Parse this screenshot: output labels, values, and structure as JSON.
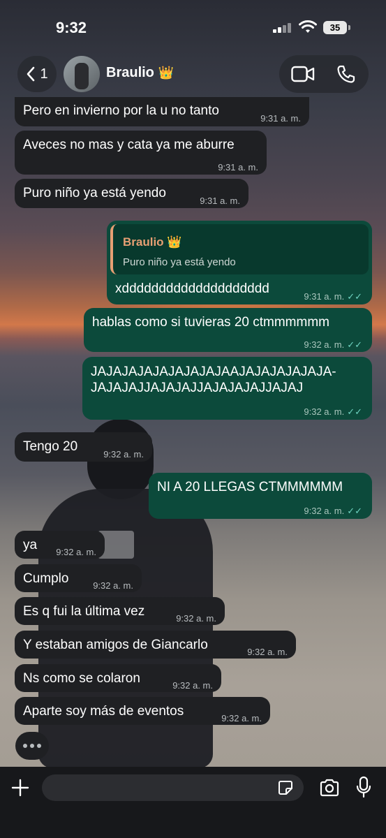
{
  "status_bar": {
    "time": "9:32",
    "battery": "35"
  },
  "header": {
    "back_count": "1",
    "contact_name": "Braulio",
    "contact_emoji": "👑",
    "icons": [
      "back-chevron-icon",
      "video-call-icon",
      "phone-icon"
    ]
  },
  "messages": [
    {
      "dir": "in",
      "text": "Pero en invierno por la u no tanto",
      "time": "9:31 a. m."
    },
    {
      "dir": "in",
      "text": "Aveces no mas y cata ya me aburre",
      "time": "9:31 a. m."
    },
    {
      "dir": "in",
      "text": "Puro niño ya está yendo",
      "time": "9:31 a. m."
    },
    {
      "dir": "out",
      "quote_name": "Braulio 👑",
      "quote_text": "Puro niño ya está yendo",
      "text": "xdddddddddddddddddddd",
      "time": "9:31 a. m."
    },
    {
      "dir": "out",
      "text": "hablas como si tuvieras 20 ctmmmmmm",
      "time": "9:32 a. m."
    },
    {
      "dir": "out",
      "text_line1": "JAJAJAJAJAJAJAJAJAAJAJAJAJAJAJA-",
      "text_line2": "JAJAJAJJAJAJAJJAJAJAJAJJAJAJ",
      "time": "9:32 a. m."
    },
    {
      "dir": "in",
      "text": "Tengo 20",
      "time": "9:32 a. m."
    },
    {
      "dir": "out",
      "text": "NI A 20 LLEGAS CTMMMMMM",
      "time": "9:32 a. m."
    },
    {
      "dir": "in",
      "text": "ya",
      "time": "9:32 a. m."
    },
    {
      "dir": "in",
      "text": "Cumplo",
      "time": "9:32 a. m."
    },
    {
      "dir": "in",
      "text": "Es q fui la última vez",
      "time": "9:32 a. m."
    },
    {
      "dir": "in",
      "text": "Y estaban amigos de Giancarlo",
      "time": "9:32 a. m."
    },
    {
      "dir": "in",
      "text": "Ns como se colaron",
      "time": "9:32 a. m."
    },
    {
      "dir": "in",
      "text": "Aparte soy más de eventos",
      "time": "9:32 a. m."
    }
  ],
  "input_bar": {
    "icons": [
      "plus-icon",
      "sticker-icon",
      "camera-icon",
      "microphone-icon"
    ]
  },
  "colors": {
    "incoming_bubble": "#1f2023",
    "outgoing_bubble": "#0c4a3b",
    "read_ticks": "#6fd3c1",
    "quote_accent": "#e79f73"
  }
}
